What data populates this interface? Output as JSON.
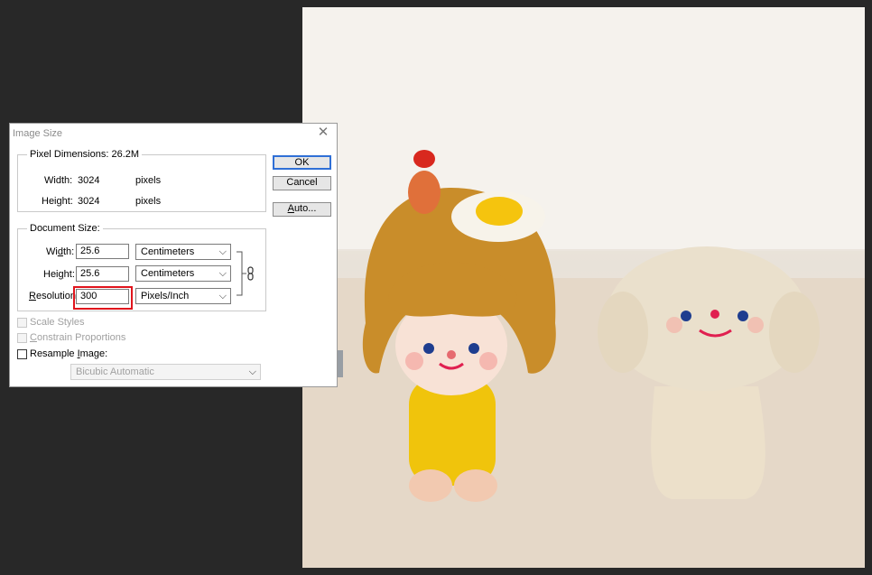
{
  "dialog": {
    "title": "Image Size",
    "close_icon": "close-icon",
    "pixel_dimensions": {
      "legend": "Pixel Dimensions:",
      "size": "26.2M",
      "width_label": "Width:",
      "width_value": "3024",
      "width_unit": "pixels",
      "height_label": "Height:",
      "height_value": "3024",
      "height_unit": "pixels"
    },
    "document_size": {
      "legend": "Document Size:",
      "width_label_pre": "Wi",
      "width_label_u": "d",
      "width_label_post": "th:",
      "width_value": "25.6",
      "width_unit": "Centimeters",
      "height_label_pre": "Hei",
      "height_label_u": "g",
      "height_label_post": "ht:",
      "height_value": "25.6",
      "height_unit": "Centimeters",
      "resolution_label_u": "R",
      "resolution_label_post": "esolution:",
      "resolution_value": "300",
      "resolution_unit": "Pixels/Inch",
      "link_icon": "chain-link-icon"
    },
    "buttons": {
      "ok": "OK",
      "cancel": "Cancel",
      "auto_u": "A",
      "auto_post": "uto..."
    },
    "options": {
      "scale_styles": "Scale Styles",
      "scale_styles_checked": false,
      "constrain_u": "C",
      "constrain_post": "onstrain Proportions",
      "constrain_checked": false,
      "resample_pre": "Resample ",
      "resample_u": "I",
      "resample_post": "mage:",
      "resample_checked": false,
      "resample_method": "Bicubic Automatic"
    },
    "highlight_color": "#e0141c",
    "default_button_color": "#2f6fd6"
  },
  "canvas": {
    "content": "photo of two clay figurines on a table",
    "background_color": "#282828"
  }
}
